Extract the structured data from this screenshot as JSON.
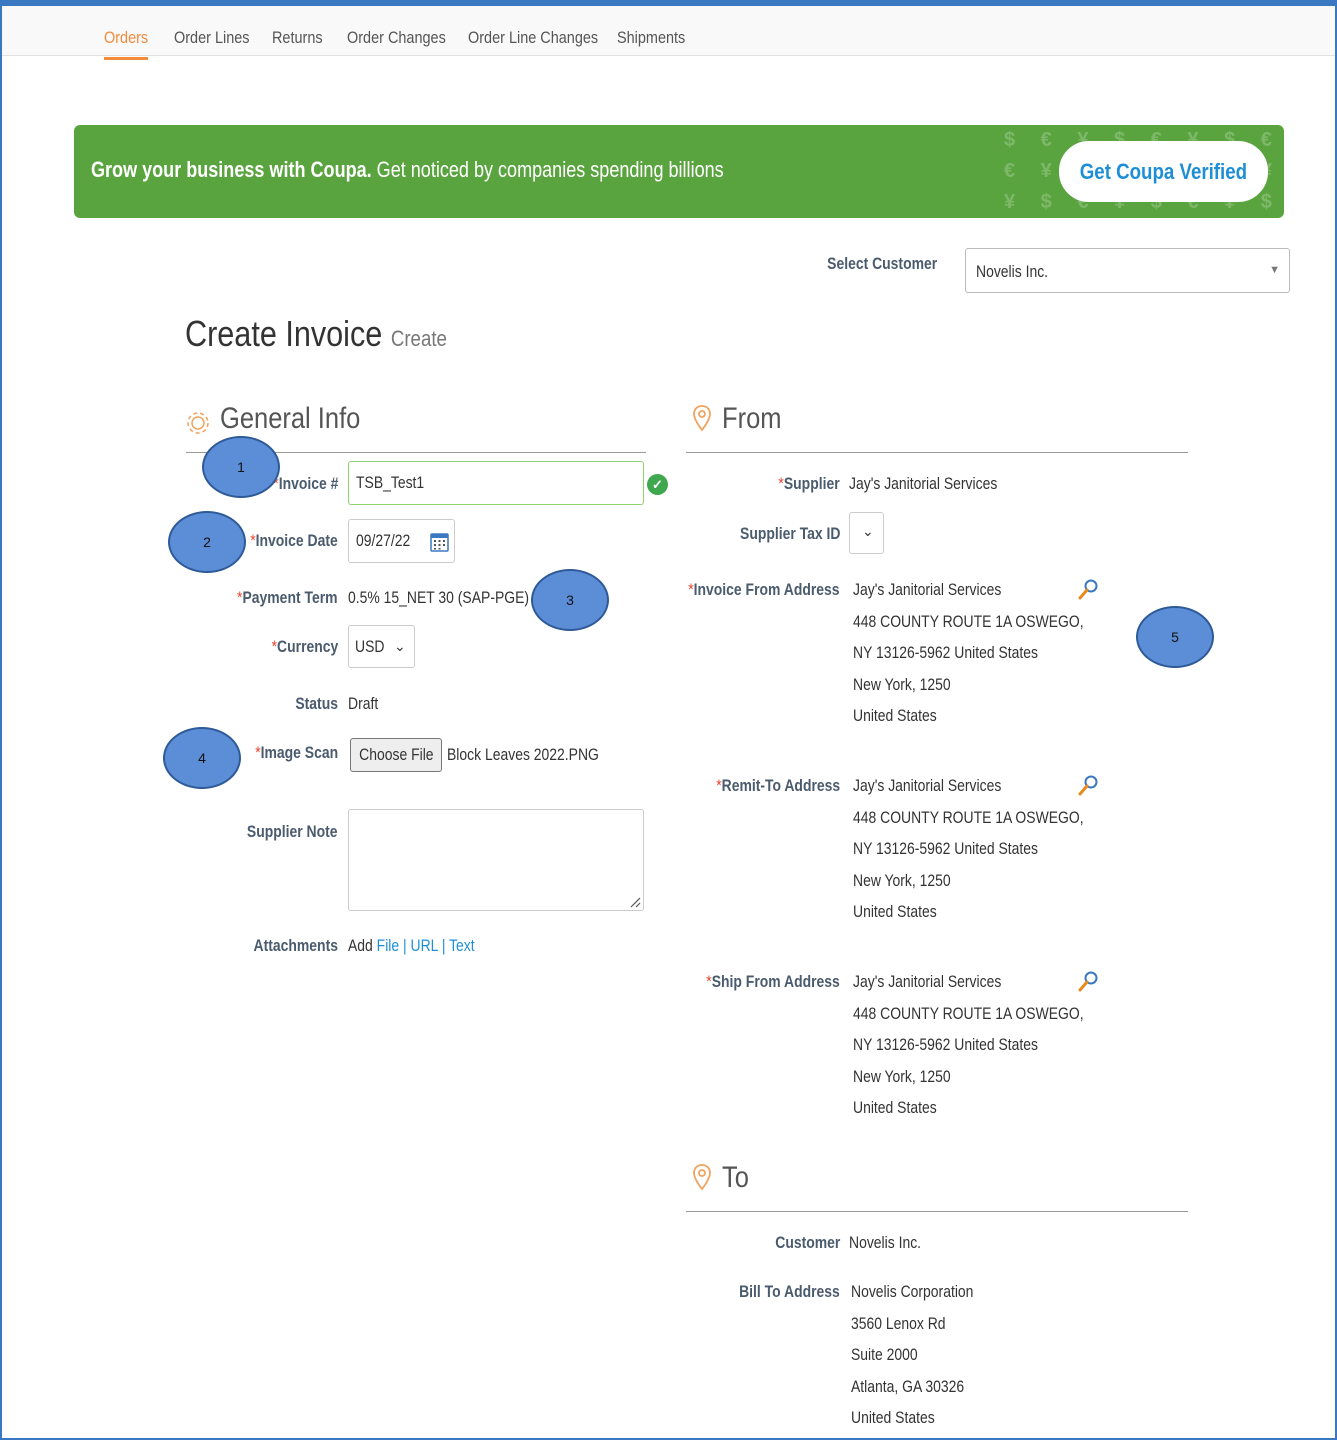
{
  "nav": {
    "tabs": [
      {
        "label": "Orders",
        "active": true
      },
      {
        "label": "Order Lines",
        "active": false
      },
      {
        "label": "Returns",
        "active": false
      },
      {
        "label": "Order Changes",
        "active": false
      },
      {
        "label": "Order Line Changes",
        "active": false
      },
      {
        "label": "Shipments",
        "active": false
      }
    ]
  },
  "banner": {
    "bold_text": "Grow your business with Coupa.",
    "text": "Get noticed by companies spending billions",
    "button_label": "Get Coupa Verified",
    "background_color": "#5aa43f"
  },
  "customer_select": {
    "label": "Select Customer",
    "value": "Novelis Inc."
  },
  "page": {
    "title": "Create Invoice",
    "subtitle": "Create"
  },
  "general_info": {
    "heading": "General Info",
    "invoice_number": {
      "label": "Invoice #",
      "value": "TSB_Test1"
    },
    "invoice_date": {
      "label": "Invoice Date",
      "value": "09/27/22"
    },
    "payment_term": {
      "label": "Payment Term",
      "value": "0.5% 15_NET 30 (SAP-PGE)"
    },
    "currency": {
      "label": "Currency",
      "value": "USD"
    },
    "status": {
      "label": "Status",
      "value": "Draft"
    },
    "image_scan": {
      "label": "Image Scan",
      "button": "Choose File",
      "file_name": "Block Leaves 2022.PNG"
    },
    "supplier_note": {
      "label": "Supplier Note",
      "value": ""
    },
    "attachments": {
      "label": "Attachments",
      "add": "Add",
      "file": "File",
      "sep1": "|",
      "url": "URL",
      "sep2": "|",
      "text": "Text"
    }
  },
  "from": {
    "heading": "From",
    "supplier": {
      "label": "Supplier",
      "value": "Jay's Janitorial Services"
    },
    "supplier_tax_id": {
      "label": "Supplier Tax ID"
    },
    "invoice_from_address": {
      "label": "Invoice From Address",
      "lines": [
        "Jay's Janitorial Services",
        "448 COUNTY ROUTE 1A OSWEGO,",
        "NY 13126-5962 United States",
        "New York, 1250",
        "United States"
      ]
    },
    "remit_to_address": {
      "label": "Remit-To Address",
      "lines": [
        "Jay's Janitorial Services",
        "448 COUNTY ROUTE 1A OSWEGO,",
        "NY 13126-5962 United States",
        "New York, 1250",
        "United States"
      ]
    },
    "ship_from_address": {
      "label": "Ship From Address",
      "lines": [
        "Jay's Janitorial Services",
        "448 COUNTY ROUTE 1A OSWEGO,",
        "NY 13126-5962 United States",
        "New York, 1250",
        "United States"
      ]
    }
  },
  "to": {
    "heading": "To",
    "customer": {
      "label": "Customer",
      "value": "Novelis Inc."
    },
    "bill_to_address": {
      "label": "Bill To Address",
      "lines": [
        "Novelis Corporation",
        "3560 Lenox Rd",
        "Suite 2000",
        "Atlanta, GA 30326",
        "United States"
      ]
    }
  },
  "callouts": [
    "1",
    "2",
    "3",
    "4",
    "5"
  ],
  "colors": {
    "accent": "#f28b3c",
    "link": "#1e8fd6",
    "required": "#e8452c",
    "callout": "#5b8ed6"
  }
}
